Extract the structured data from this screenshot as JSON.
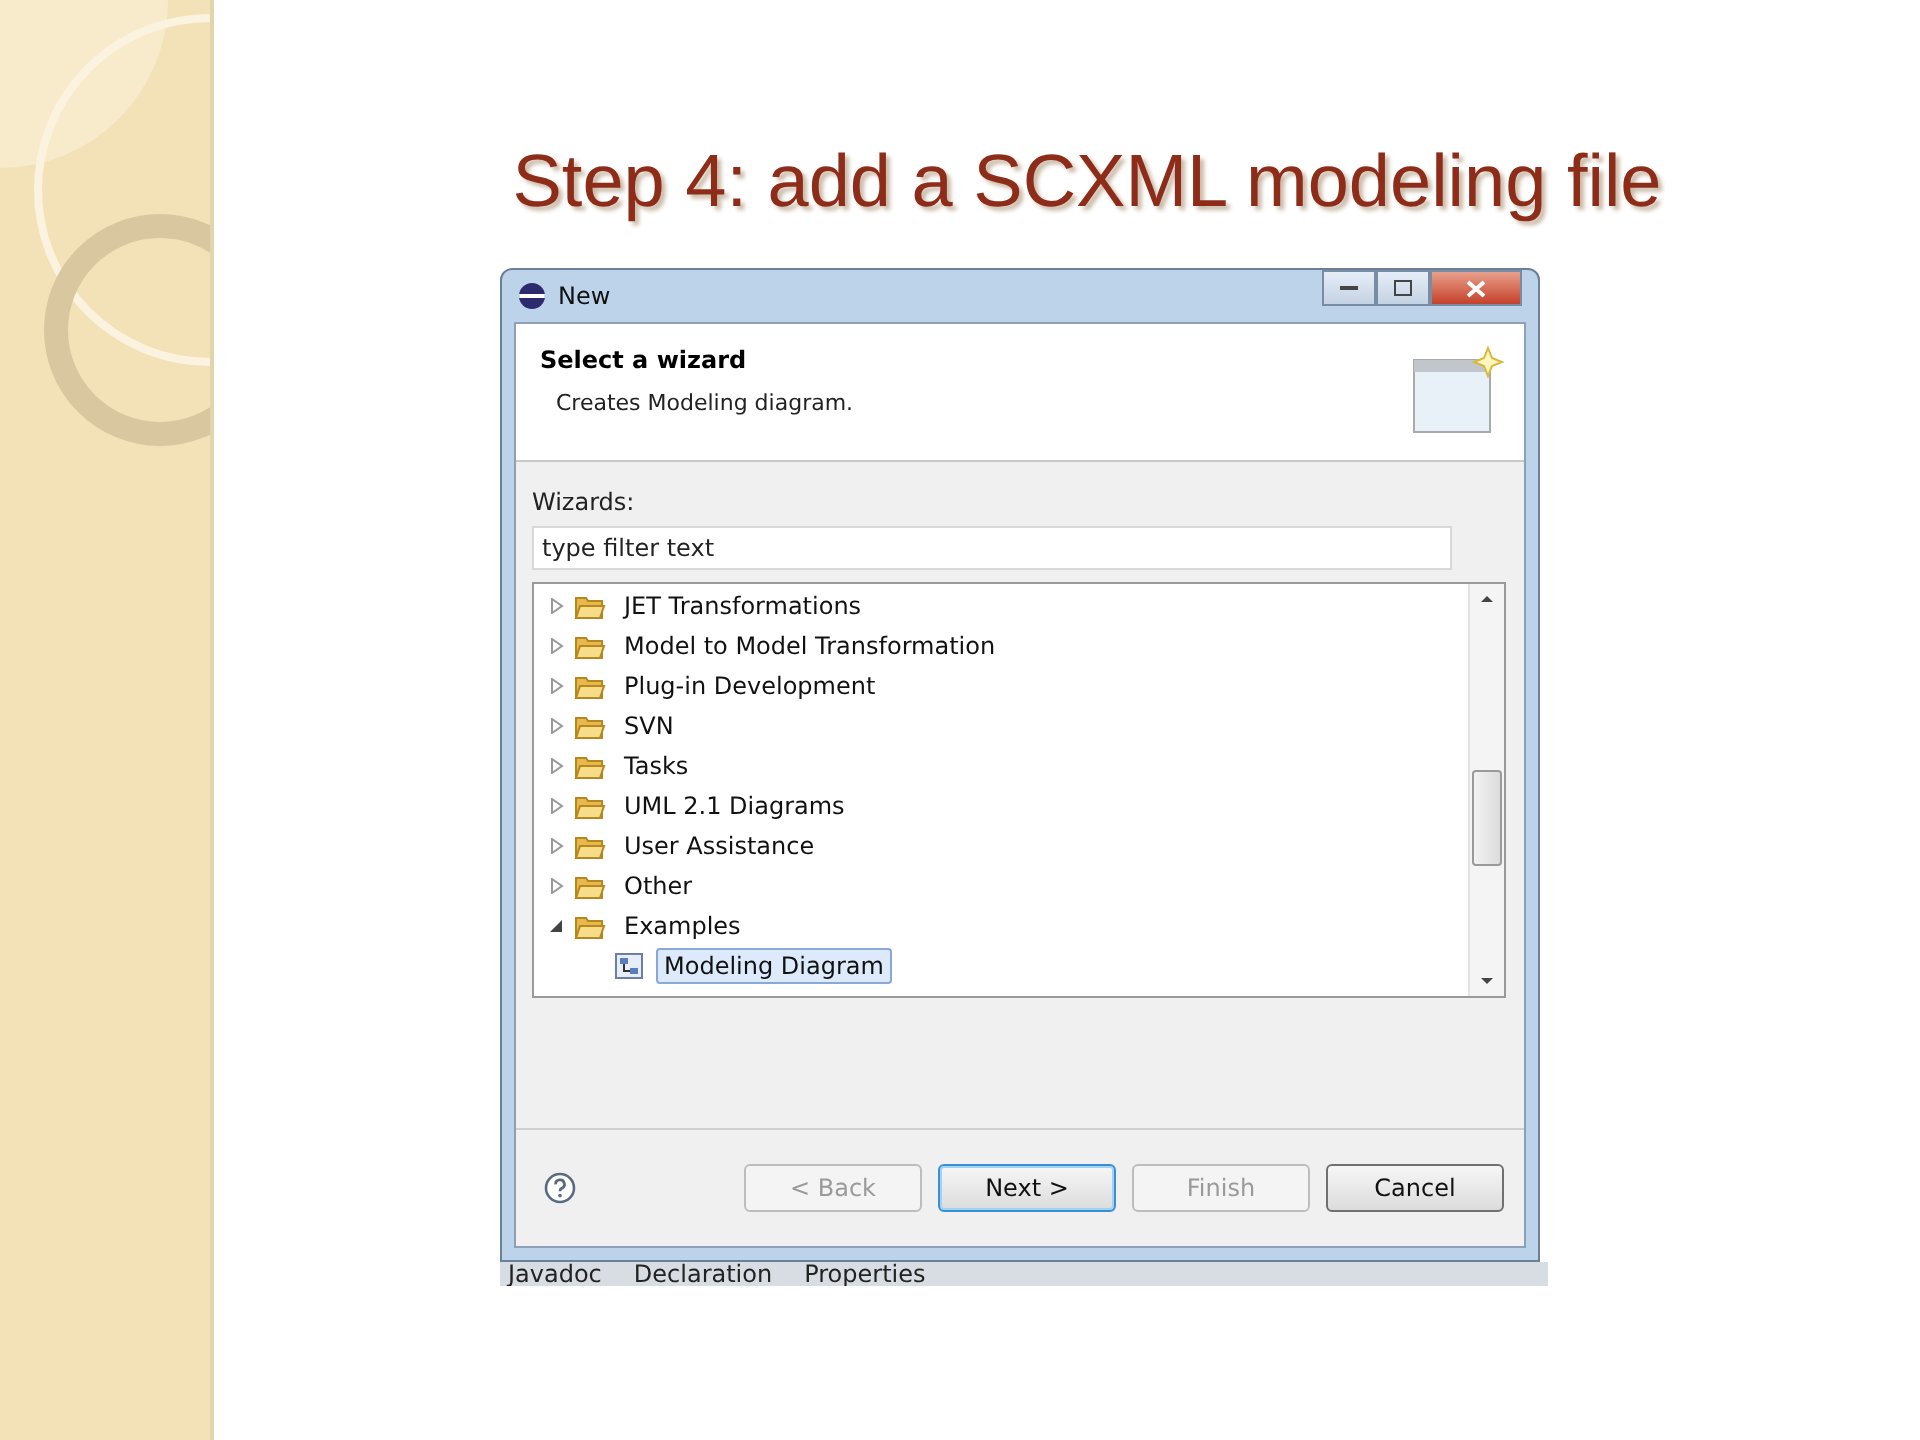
{
  "slide_title": "Step 4: add a SCXML modeling file",
  "window": {
    "title": "New"
  },
  "header": {
    "title": "Select a wizard",
    "description": "Creates Modeling diagram."
  },
  "wizards_label": "Wizards:",
  "filter": {
    "placeholder": "type filter text"
  },
  "tree": [
    {
      "label": "JET Transformations",
      "expanded": false,
      "selected": false
    },
    {
      "label": "Model to Model Transformation",
      "expanded": false,
      "selected": false
    },
    {
      "label": "Plug-in Development",
      "expanded": false,
      "selected": false
    },
    {
      "label": "SVN",
      "expanded": false,
      "selected": false
    },
    {
      "label": "Tasks",
      "expanded": false,
      "selected": false
    },
    {
      "label": "UML 2.1 Diagrams",
      "expanded": false,
      "selected": false
    },
    {
      "label": "User Assistance",
      "expanded": false,
      "selected": false
    },
    {
      "label": "Other",
      "expanded": false,
      "selected": false
    },
    {
      "label": "Examples",
      "expanded": true,
      "selected": false,
      "children": [
        {
          "label": "Modeling Diagram",
          "selected": true
        }
      ]
    }
  ],
  "buttons": [
    {
      "label": "< Back",
      "disabled": true,
      "default": false
    },
    {
      "label": "Next >",
      "disabled": false,
      "default": true
    },
    {
      "label": "Finish",
      "disabled": true,
      "default": false
    },
    {
      "label": "Cancel",
      "disabled": false,
      "default": false
    }
  ],
  "background_tabs": [
    "Javadoc",
    "Declaration",
    "Properties"
  ]
}
